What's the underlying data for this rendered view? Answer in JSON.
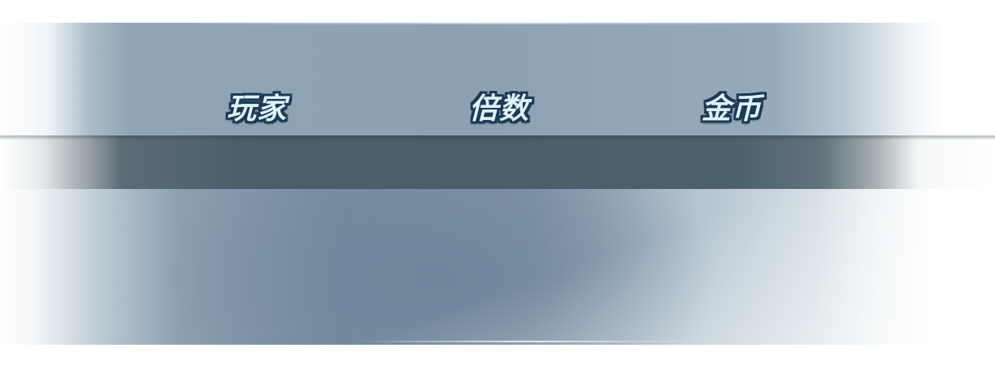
{
  "table_header": {
    "columns": [
      {
        "key": "player",
        "label": "玩家"
      },
      {
        "key": "multiplier",
        "label": "倍数"
      },
      {
        "key": "gold",
        "label": "金币"
      }
    ]
  },
  "colors": {
    "header_band": "#8ca2b2",
    "dark_strip": "#4a5e6a",
    "content_panel": "#768ca0",
    "label_fill": "#ddf3ff",
    "label_outline": "#1d3a53"
  }
}
